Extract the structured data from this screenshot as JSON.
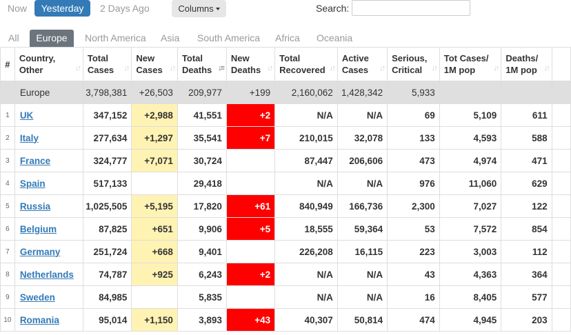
{
  "toolbar": {
    "now": "Now",
    "yesterday": "Yesterday",
    "two_days_ago": "2 Days Ago",
    "columns": "Columns",
    "search_label": "Search:",
    "search_value": "",
    "active_color": "#337ab7"
  },
  "tabs": [
    {
      "label": "All"
    },
    {
      "label": "Europe"
    },
    {
      "label": "North America"
    },
    {
      "label": "Asia"
    },
    {
      "label": "South America"
    },
    {
      "label": "Africa"
    },
    {
      "label": "Oceania"
    }
  ],
  "active_tab": "Europe",
  "columns": [
    {
      "l1": "#",
      "l2": ""
    },
    {
      "l1": "Country,",
      "l2": "Other"
    },
    {
      "l1": "Total",
      "l2": "Cases"
    },
    {
      "l1": "New",
      "l2": "Cases"
    },
    {
      "l1": "Total",
      "l2": "Deaths"
    },
    {
      "l1": "New",
      "l2": "Deaths"
    },
    {
      "l1": "Total",
      "l2": "Recovered"
    },
    {
      "l1": "Active",
      "l2": "Cases"
    },
    {
      "l1": "Serious,",
      "l2": "Critical"
    },
    {
      "l1": "Tot Cases/",
      "l2": "1M pop"
    },
    {
      "l1": "Deaths/",
      "l2": "1M pop"
    }
  ],
  "total_row": {
    "country": "Europe",
    "total_cases": "3,798,381",
    "new_cases": "+26,503",
    "total_deaths": "209,977",
    "new_deaths": "+199",
    "total_recovered": "2,160,062",
    "active_cases": "1,428,342",
    "serious": "5,933",
    "cases_per_1m": "",
    "deaths_per_1m": ""
  },
  "rows": [
    {
      "n": "1",
      "country": "UK",
      "total_cases": "347,152",
      "new_cases": "+2,988",
      "total_deaths": "41,551",
      "new_deaths": "+2",
      "total_recovered": "N/A",
      "active_cases": "N/A",
      "serious": "69",
      "cases_per_1m": "5,109",
      "deaths_per_1m": "611"
    },
    {
      "n": "2",
      "country": "Italy",
      "total_cases": "277,634",
      "new_cases": "+1,297",
      "total_deaths": "35,541",
      "new_deaths": "+7",
      "total_recovered": "210,015",
      "active_cases": "32,078",
      "serious": "133",
      "cases_per_1m": "4,593",
      "deaths_per_1m": "588"
    },
    {
      "n": "3",
      "country": "France",
      "total_cases": "324,777",
      "new_cases": "+7,071",
      "total_deaths": "30,724",
      "new_deaths": "",
      "total_recovered": "87,447",
      "active_cases": "206,606",
      "serious": "473",
      "cases_per_1m": "4,974",
      "deaths_per_1m": "471"
    },
    {
      "n": "4",
      "country": "Spain",
      "total_cases": "517,133",
      "new_cases": "",
      "total_deaths": "29,418",
      "new_deaths": "",
      "total_recovered": "N/A",
      "active_cases": "N/A",
      "serious": "976",
      "cases_per_1m": "11,060",
      "deaths_per_1m": "629"
    },
    {
      "n": "5",
      "country": "Russia",
      "total_cases": "1,025,505",
      "new_cases": "+5,195",
      "total_deaths": "17,820",
      "new_deaths": "+61",
      "total_recovered": "840,949",
      "active_cases": "166,736",
      "serious": "2,300",
      "cases_per_1m": "7,027",
      "deaths_per_1m": "122"
    },
    {
      "n": "6",
      "country": "Belgium",
      "total_cases": "87,825",
      "new_cases": "+651",
      "total_deaths": "9,906",
      "new_deaths": "+5",
      "total_recovered": "18,555",
      "active_cases": "59,364",
      "serious": "53",
      "cases_per_1m": "7,572",
      "deaths_per_1m": "854"
    },
    {
      "n": "7",
      "country": "Germany",
      "total_cases": "251,724",
      "new_cases": "+668",
      "total_deaths": "9,401",
      "new_deaths": "",
      "total_recovered": "226,208",
      "active_cases": "16,115",
      "serious": "223",
      "cases_per_1m": "3,003",
      "deaths_per_1m": "112"
    },
    {
      "n": "8",
      "country": "Netherlands",
      "total_cases": "74,787",
      "new_cases": "+925",
      "total_deaths": "6,243",
      "new_deaths": "+2",
      "total_recovered": "N/A",
      "active_cases": "N/A",
      "serious": "43",
      "cases_per_1m": "4,363",
      "deaths_per_1m": "364"
    },
    {
      "n": "9",
      "country": "Sweden",
      "total_cases": "84,985",
      "new_cases": "",
      "total_deaths": "5,835",
      "new_deaths": "",
      "total_recovered": "N/A",
      "active_cases": "N/A",
      "serious": "16",
      "cases_per_1m": "8,405",
      "deaths_per_1m": "577"
    },
    {
      "n": "10",
      "country": "Romania",
      "total_cases": "95,014",
      "new_cases": "+1,150",
      "total_deaths": "3,893",
      "new_deaths": "+43",
      "total_recovered": "40,307",
      "active_cases": "50,814",
      "serious": "474",
      "cases_per_1m": "4,945",
      "deaths_per_1m": "203"
    }
  ],
  "colors": {
    "new_cases_bg": "#fff3b4",
    "new_deaths_bg": "#ff0000",
    "total_row_bg": "#dfdfdf",
    "link": "#337ab7"
  }
}
